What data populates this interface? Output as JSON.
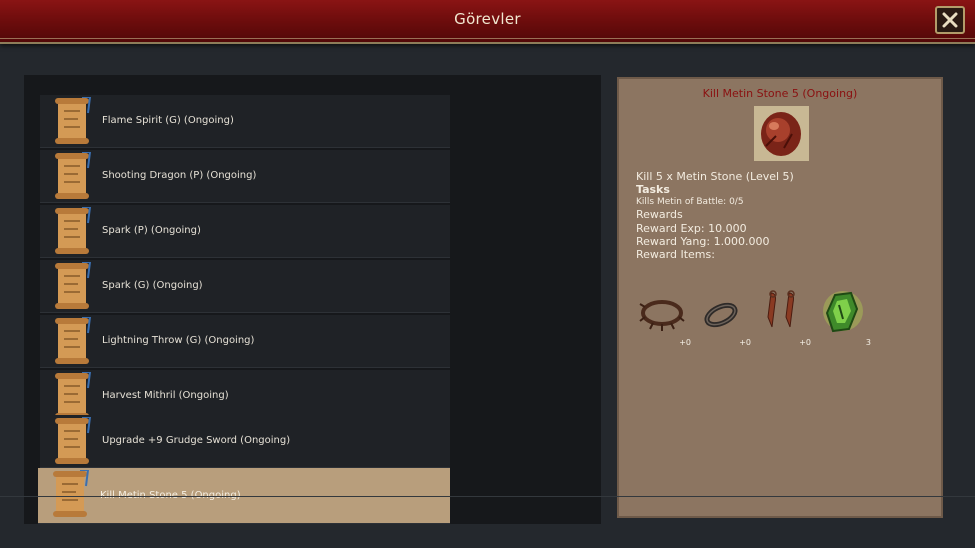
{
  "window": {
    "title": "Görevler",
    "close_icon": "close-icon"
  },
  "quests": [
    {
      "label": "Flame Spirit (G) (Ongoing)",
      "icon": "quest-scroll-icon",
      "selected": false
    },
    {
      "label": "Shooting Dragon (P) (Ongoing)",
      "icon": "quest-scroll-icon",
      "selected": false
    },
    {
      "label": "Spark (P) (Ongoing)",
      "icon": "quest-scroll-icon",
      "selected": false
    },
    {
      "label": "Spark (G) (Ongoing)",
      "icon": "quest-scroll-icon",
      "selected": false
    },
    {
      "label": "Lightning Throw (G) (Ongoing)",
      "icon": "quest-scroll-icon",
      "selected": false
    },
    {
      "label": "Harvest Mithril (Ongoing)",
      "icon": "quest-scroll-icon",
      "selected": false
    },
    {
      "label": "Upgrade +9 Grudge Sword (Ongoing)",
      "icon": "quest-scroll-icon",
      "selected": false
    },
    {
      "label": "Kill Metin Stone 5  (Ongoing)",
      "icon": "quest-scroll-icon",
      "selected": true
    }
  ],
  "detail": {
    "title": "Kill Metin Stone 5  (Ongoing)",
    "icon": "metin-stone-icon",
    "description": "Kill  5 x Metin Stone (Level 5)",
    "tasks_heading": "Tasks",
    "task_progress": "Kills Metin of Battle: 0/5",
    "rewards_heading": "Rewards",
    "reward_exp": "Reward Exp: 10.000",
    "reward_yang": "Reward Yang: 1.000.000",
    "reward_items_heading": "Reward Items:",
    "reward_items": [
      {
        "icon": "spiked-necklace-icon",
        "count": "+0"
      },
      {
        "icon": "bracelet-icon",
        "count": "+0"
      },
      {
        "icon": "earrings-icon",
        "count": "+0"
      },
      {
        "icon": "green-crystal-icon",
        "count": "3"
      }
    ]
  },
  "colors": {
    "titlebar": "#7a1010",
    "detail_title": "#8a1010",
    "selected_row": "#b89e7c",
    "parchment": "#8c7561"
  }
}
